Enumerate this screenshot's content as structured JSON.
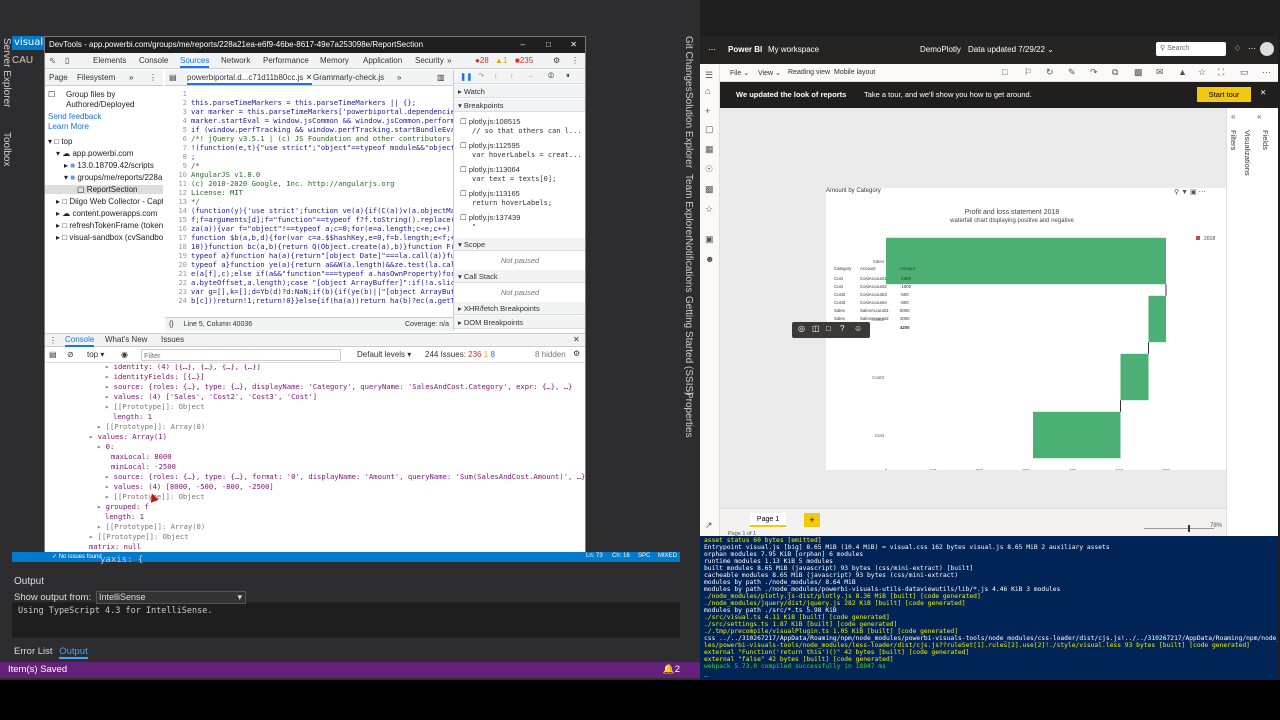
{
  "vs": {
    "tab_label": "visual.t",
    "tab2_label": "CAU",
    "left_vertical": [
      "Server Explorer",
      "Toolbox"
    ],
    "right_vertical": [
      "Git Changes",
      "Solution Explorer",
      "Team Explorer",
      "Notifications",
      "Getting Started (SSIS)",
      "Properties"
    ],
    "output_title": "Output",
    "show_output_label": "Show output from:",
    "show_output_value": "IntelliSense",
    "output_text": "Using TypeScript 4.3 for IntelliSense.",
    "error_list_tab": "Error List",
    "output_tab": "Output",
    "status_text": "Item(s) Saved",
    "statusbar_badge": "2",
    "bottom_strip_text": "No issues found",
    "bottom_strip_right": [
      "Ln: 73",
      "Ch: 16",
      "SPC",
      "MIXED"
    ]
  },
  "devtools": {
    "title": "DevTools - app.powerbi.com/groups/me/reports/228a21ea-e6f9-46be-8617-49e7a253098e/ReportSection",
    "tabs": [
      "Elements",
      "Console",
      "Sources",
      "Network",
      "Performance",
      "Memory",
      "Application",
      "Security"
    ],
    "active_tab": "Sources",
    "badges": {
      "errors": "28",
      "warnings": "1",
      "issues": "235"
    },
    "nav_tabs": [
      "Page",
      "Filesystem"
    ],
    "group_files_label": "Group files by Authored/Deployed",
    "send_feedback": "Send feedback",
    "learn_more": "Learn More",
    "tree": [
      {
        "depth": 0,
        "text": "top"
      },
      {
        "depth": 1,
        "text": "app.powerbi.com"
      },
      {
        "depth": 2,
        "text": "13.0.18709.42/scripts"
      },
      {
        "depth": 2,
        "text": "groups/me/reports/228a"
      },
      {
        "depth": 3,
        "text": "ReportSection"
      },
      {
        "depth": 1,
        "text": "Diigo Web Collector - Capt"
      },
      {
        "depth": 1,
        "text": "content.powerapps.com"
      },
      {
        "depth": 1,
        "text": "refreshTokenFrame (tokenF"
      },
      {
        "depth": 1,
        "text": "visual-sandbox (cvSandbox"
      }
    ],
    "source_tabs": [
      "powerbiportal.d...c71d11b80cc.js",
      "Grammarly-check.js"
    ],
    "code_lines": [
      {
        "n": "1",
        "t": ""
      },
      {
        "n": "2",
        "t": "this.parseTimeMarkers = this.parseTimeMarkers || {};"
      },
      {
        "n": "3",
        "t": "var marker = this.parseTimeMarkers['powerbiportal.dependencies"
      },
      {
        "n": "4",
        "t": "marker.startEval = window.jsCommon && window.jsCommon.perform"
      },
      {
        "n": "5",
        "t": "if (window.perfTracking && window.perfTracking.startBundleEva"
      },
      {
        "n": "6",
        "t": "/*! jQuery v3.5.1 | (c) JS Foundation and other contributors"
      },
      {
        "n": "7",
        "t": "!(function(e,t){\"use strict\";\"object\"==typeof module&&\"object"
      },
      {
        "n": "8",
        "t": ";"
      },
      {
        "n": "9",
        "t": "/*"
      },
      {
        "n": "10",
        "t": " AngularJS v1.8.0"
      },
      {
        "n": "11",
        "t": " (c) 2010-2020 Google, Inc. http://angularjs.org"
      },
      {
        "n": "12",
        "t": " License: MIT"
      },
      {
        "n": "13",
        "t": "*/"
      },
      {
        "n": "14",
        "t": "(function(y){'use strict';function ve(a){if(C(a))v(a.objectMa"
      },
      {
        "n": "15",
        "t": "f;f=arguments[d];f=\"function\"==typeof f?f.toString().replace("
      },
      {
        "n": "16",
        "t": "za(a)){var f=\"object\"!==typeof a;c=0;for(e=a.length;c<e;c++)"
      },
      {
        "n": "17",
        "t": "function $b(a,b,d){for(var c=a.$$hashKey,e=0,f=b.length;e<f;+"
      },
      {
        "n": "18",
        "t": "10)}function bc(a,b){return Q(Object.create(a),b)}function F("
      },
      {
        "n": "19",
        "t": "typeof a}function ha(a){return\"[object Date]\"===la.call(a)}fu"
      },
      {
        "n": "20",
        "t": "typeof a}function ye(a){return a&&W(a.length)&&ze.test(la.cal"
      },
      {
        "n": "21",
        "t": "e(a[f],c);else if(a&&\"function\"===typeof a.hasOwnProperty)for"
      },
      {
        "n": "22",
        "t": "a.byteOffset,a.length);case \"[object ArrayBuffer]\":if(!a.slic"
      },
      {
        "n": "23",
        "t": "var g=[],k=[];d=Yb(d)?d:NaN;if(b){if(ye(b)||\"[object ArrayBuf"
      },
      {
        "n": "24",
        "t": "b[c]))return!1;return!0}}else{if(ha(a))return ha(b)?ec(a.getT"
      }
    ],
    "status_left": "Line 5, Column 40036",
    "status_right": "Coverage: n/a",
    "watch": "Watch",
    "breakpoints_title": "Breakpoints",
    "breakpoints": [
      {
        "file": "plotly.js:108515",
        "code": "// so that others can l..."
      },
      {
        "file": "plotly.js:112595",
        "code": "var hoverLabels = creat..."
      },
      {
        "file": "plotly.js:113064",
        "code": "var text = texts[0];"
      },
      {
        "file": "plotly.js:113165",
        "code": "return hoverLabels;"
      },
      {
        "file": "plotly.js:137439",
        "code": "\""
      }
    ],
    "scope": "Scope",
    "not_paused": "Not paused",
    "call_stack": "Call Stack",
    "not_paused2": "Not paused",
    "xhr": "XHR/fetch Breakpoints",
    "dom": "DOM Breakpoints",
    "console_tabs": [
      "Console",
      "What's New",
      "Issues"
    ],
    "console_context": "top",
    "filter_placeholder": "Filter",
    "default_levels": "Default levels",
    "issues_count": "244 Issues:",
    "issue_badges": [
      "236",
      "1",
      "8"
    ],
    "hidden_count": "8 hidden",
    "console_lines": [
      {
        "indent": 60,
        "text": "identity: (4) [{…}, {…}, {…}, {…}]",
        "cls": "purple"
      },
      {
        "indent": 60,
        "text": "identityFields: [{…}]",
        "cls": "purple"
      },
      {
        "indent": 60,
        "text": "source: {roles: {…}, type: {…}, displayName: 'Category', queryName: 'SalesAndCost.Category', expr: {…}, …}",
        "cls": "purple"
      },
      {
        "indent": 60,
        "text": "values: (4) ['Sales', 'Cost2', 'Cost3', 'Cost']",
        "cls": "purple"
      },
      {
        "indent": 60,
        "text": "[[Prototype]]: Object",
        "cls": "gray"
      },
      {
        "indent": 68,
        "text": "length: 1",
        "cls": "purple"
      },
      {
        "indent": 52,
        "text": "[[Prototype]]: Array(0)",
        "cls": "gray"
      },
      {
        "indent": 44,
        "text": "values: Array(1)",
        "cls": "purple"
      },
      {
        "indent": 52,
        "text": "0:",
        "cls": "purple"
      },
      {
        "indent": 66,
        "text": "maxLocal: 8000",
        "cls": "purple"
      },
      {
        "indent": 66,
        "text": "minLocal: -2500",
        "cls": "purple"
      },
      {
        "indent": 60,
        "text": "source: {roles: {…}, type: {…}, format: '0', displayName: 'Amount', queryName: 'Sum(SalesAndCost.Amount)', …}",
        "cls": "purple"
      },
      {
        "indent": 60,
        "text": "values: (4) [8000, -500, -800, -2500]",
        "cls": "purple"
      },
      {
        "indent": 60,
        "text": "[[Prototype]]: Object",
        "cls": "gray"
      },
      {
        "indent": 52,
        "text": "grouped: f",
        "cls": "purple"
      },
      {
        "indent": 60,
        "text": "length: 1",
        "cls": "purple"
      },
      {
        "indent": 52,
        "text": "[[Prototype]]: Array(0)",
        "cls": "gray"
      },
      {
        "indent": 44,
        "text": "[[Prototype]]: Object",
        "cls": "gray"
      },
      {
        "indent": 44,
        "text": "matrix: null",
        "cls": "purple"
      }
    ],
    "under_line": "yaxis: {"
  },
  "powerbi": {
    "app_name": "Power BI",
    "workspace": "My workspace",
    "report_name": "DemoPlotly",
    "data_updated": "Data updated 7/29/22",
    "search_placeholder": "Search",
    "menu": [
      "File",
      "View",
      "Reading view",
      "Mobile layout"
    ],
    "banner_bold": "We updated the look of reports",
    "banner_text": "Take a tour, and we'll show you how to get around.",
    "start_tour": "Start tour",
    "visual_header": "Amount by Category",
    "chart_title": "Profit and loss statement 2018",
    "chart_subtitle": "waterfall chart displaying positive and negative",
    "legend": "2018",
    "table_headers": [
      "Category",
      "Account",
      "Amount"
    ],
    "table_rows": [
      [
        "Cost",
        "CostAccount1",
        "-1000"
      ],
      [
        "Cost",
        "CostAccount2",
        "-1500"
      ],
      [
        "Cost2",
        "CostAccount3",
        "-500"
      ],
      [
        "Cost3",
        "CostAccount4",
        "-800"
      ],
      [
        "Sales",
        "SalesAccount1",
        "5000"
      ],
      [
        "Sales",
        "SalesAccount2",
        "3000"
      ]
    ],
    "table_total_label": "Total",
    "table_total_value": "4200",
    "y_categories": [
      "Sales",
      "Cost2",
      "Cost3",
      "Cost"
    ],
    "x_ticks": [
      "0",
      "100",
      "200",
      "300",
      "400",
      "500",
      "600"
    ],
    "page_tab": "Page 1",
    "page_count": "Page 1 of 1",
    "zoom": "78%",
    "panes": [
      "Filters",
      "Visualizations",
      "Fields"
    ]
  },
  "chart_data": {
    "type": "bar",
    "orientation": "horizontal waterfall",
    "categories": [
      "Sales",
      "Cost2",
      "Cost3",
      "Cost"
    ],
    "bars": [
      {
        "category": "Sales",
        "start": 0,
        "end": 8000
      },
      {
        "category": "Cost2",
        "start": 8000,
        "end": 7500
      },
      {
        "category": "Cost3",
        "start": 7500,
        "end": 6700
      },
      {
        "category": "Cost",
        "start": 6700,
        "end": 4200
      }
    ],
    "axis_ticks": [
      "0",
      "100",
      "200",
      "300",
      "400",
      "500",
      "600"
    ],
    "legend": "2018",
    "title": "Profit and loss statement 2018",
    "subtitle": "waterfall chart displaying positive and negative",
    "color": "#4caf73",
    "xlim": [
      0,
      8000
    ]
  },
  "terminal": {
    "lines": [
      {
        "c": "tw",
        "t": "asset status 60 bytes [emitted]"
      },
      {
        "c": "tw",
        "t": "Entrypoint visual.js [big] 8.65 MiB (10.4 MiB) = visual.css 162 bytes visual.js 8.65 MiB 2 auxiliary assets"
      },
      {
        "c": "tw",
        "t": "orphan modules 7.95 KiB [orphan] 6 modules"
      },
      {
        "c": "tw",
        "t": "runtime modules 1.13 KiB 5 modules"
      },
      {
        "c": "tw",
        "t": "built modules 8.65 MiB (javascript) 93 bytes (css/mini-extract) [built]"
      },
      {
        "c": "tw",
        "t": "  cacheable modules 8.65 MiB (javascript) 93 bytes (css/mini-extract)"
      },
      {
        "c": "tw",
        "t": "    modules by path ./node_modules/ 8.64 MiB"
      },
      {
        "c": "tw",
        "t": "      modules by path ./node_modules/powerbi-visuals-utils-dataviewutils/lib/*.js 4.46 KiB 3 modules"
      },
      {
        "c": "tw",
        "t": "      ./node_modules/plotly.js-dist/plotly.js 8.36 MiB [built] [code generated]"
      },
      {
        "c": "tw",
        "t": "      ./node_modules/jquery/dist/jquery.js 282 KiB [built] [code generated]"
      },
      {
        "c": "tw",
        "t": "    modules by path ./src/*.ts 5.98 KiB"
      },
      {
        "c": "tw",
        "t": "      ./src/visual.ts 4.11 KiB [built] [code generated]"
      },
      {
        "c": "tw",
        "t": "      ./src/settings.ts 1.87 KiB [built] [code generated]"
      },
      {
        "c": "tw",
        "t": "    ./.tmp/precompile/visualPlugin.ts 1.05 KiB [built] [code generated]"
      },
      {
        "c": "tw",
        "t": "    css ../../310267217/AppData/Roaming/npm/node_modules/powerbi-visuals-tools/node_modules/css-loader/dist/cjs.js!../../310267217/AppData/Roaming/npm/node_modu"
      },
      {
        "c": "tw",
        "t": "les/powerbi-visuals-tools/node_modules/less-loader/dist/cjs.js??ruleSet[1].rules[2].use[2]!./style/visual.less 93 bytes [built] [code generated]"
      },
      {
        "c": "tw",
        "t": "  external \"Function('return this')()\" 42 bytes [built] [code generated]"
      },
      {
        "c": "tw",
        "t": "  external \"false\" 42 bytes [built] [code generated]"
      },
      {
        "c": "tw",
        "t": "webpack 5.73.0 compiled successfully in 18847 ms"
      },
      {
        "c": "tw",
        "t": "_"
      }
    ]
  }
}
